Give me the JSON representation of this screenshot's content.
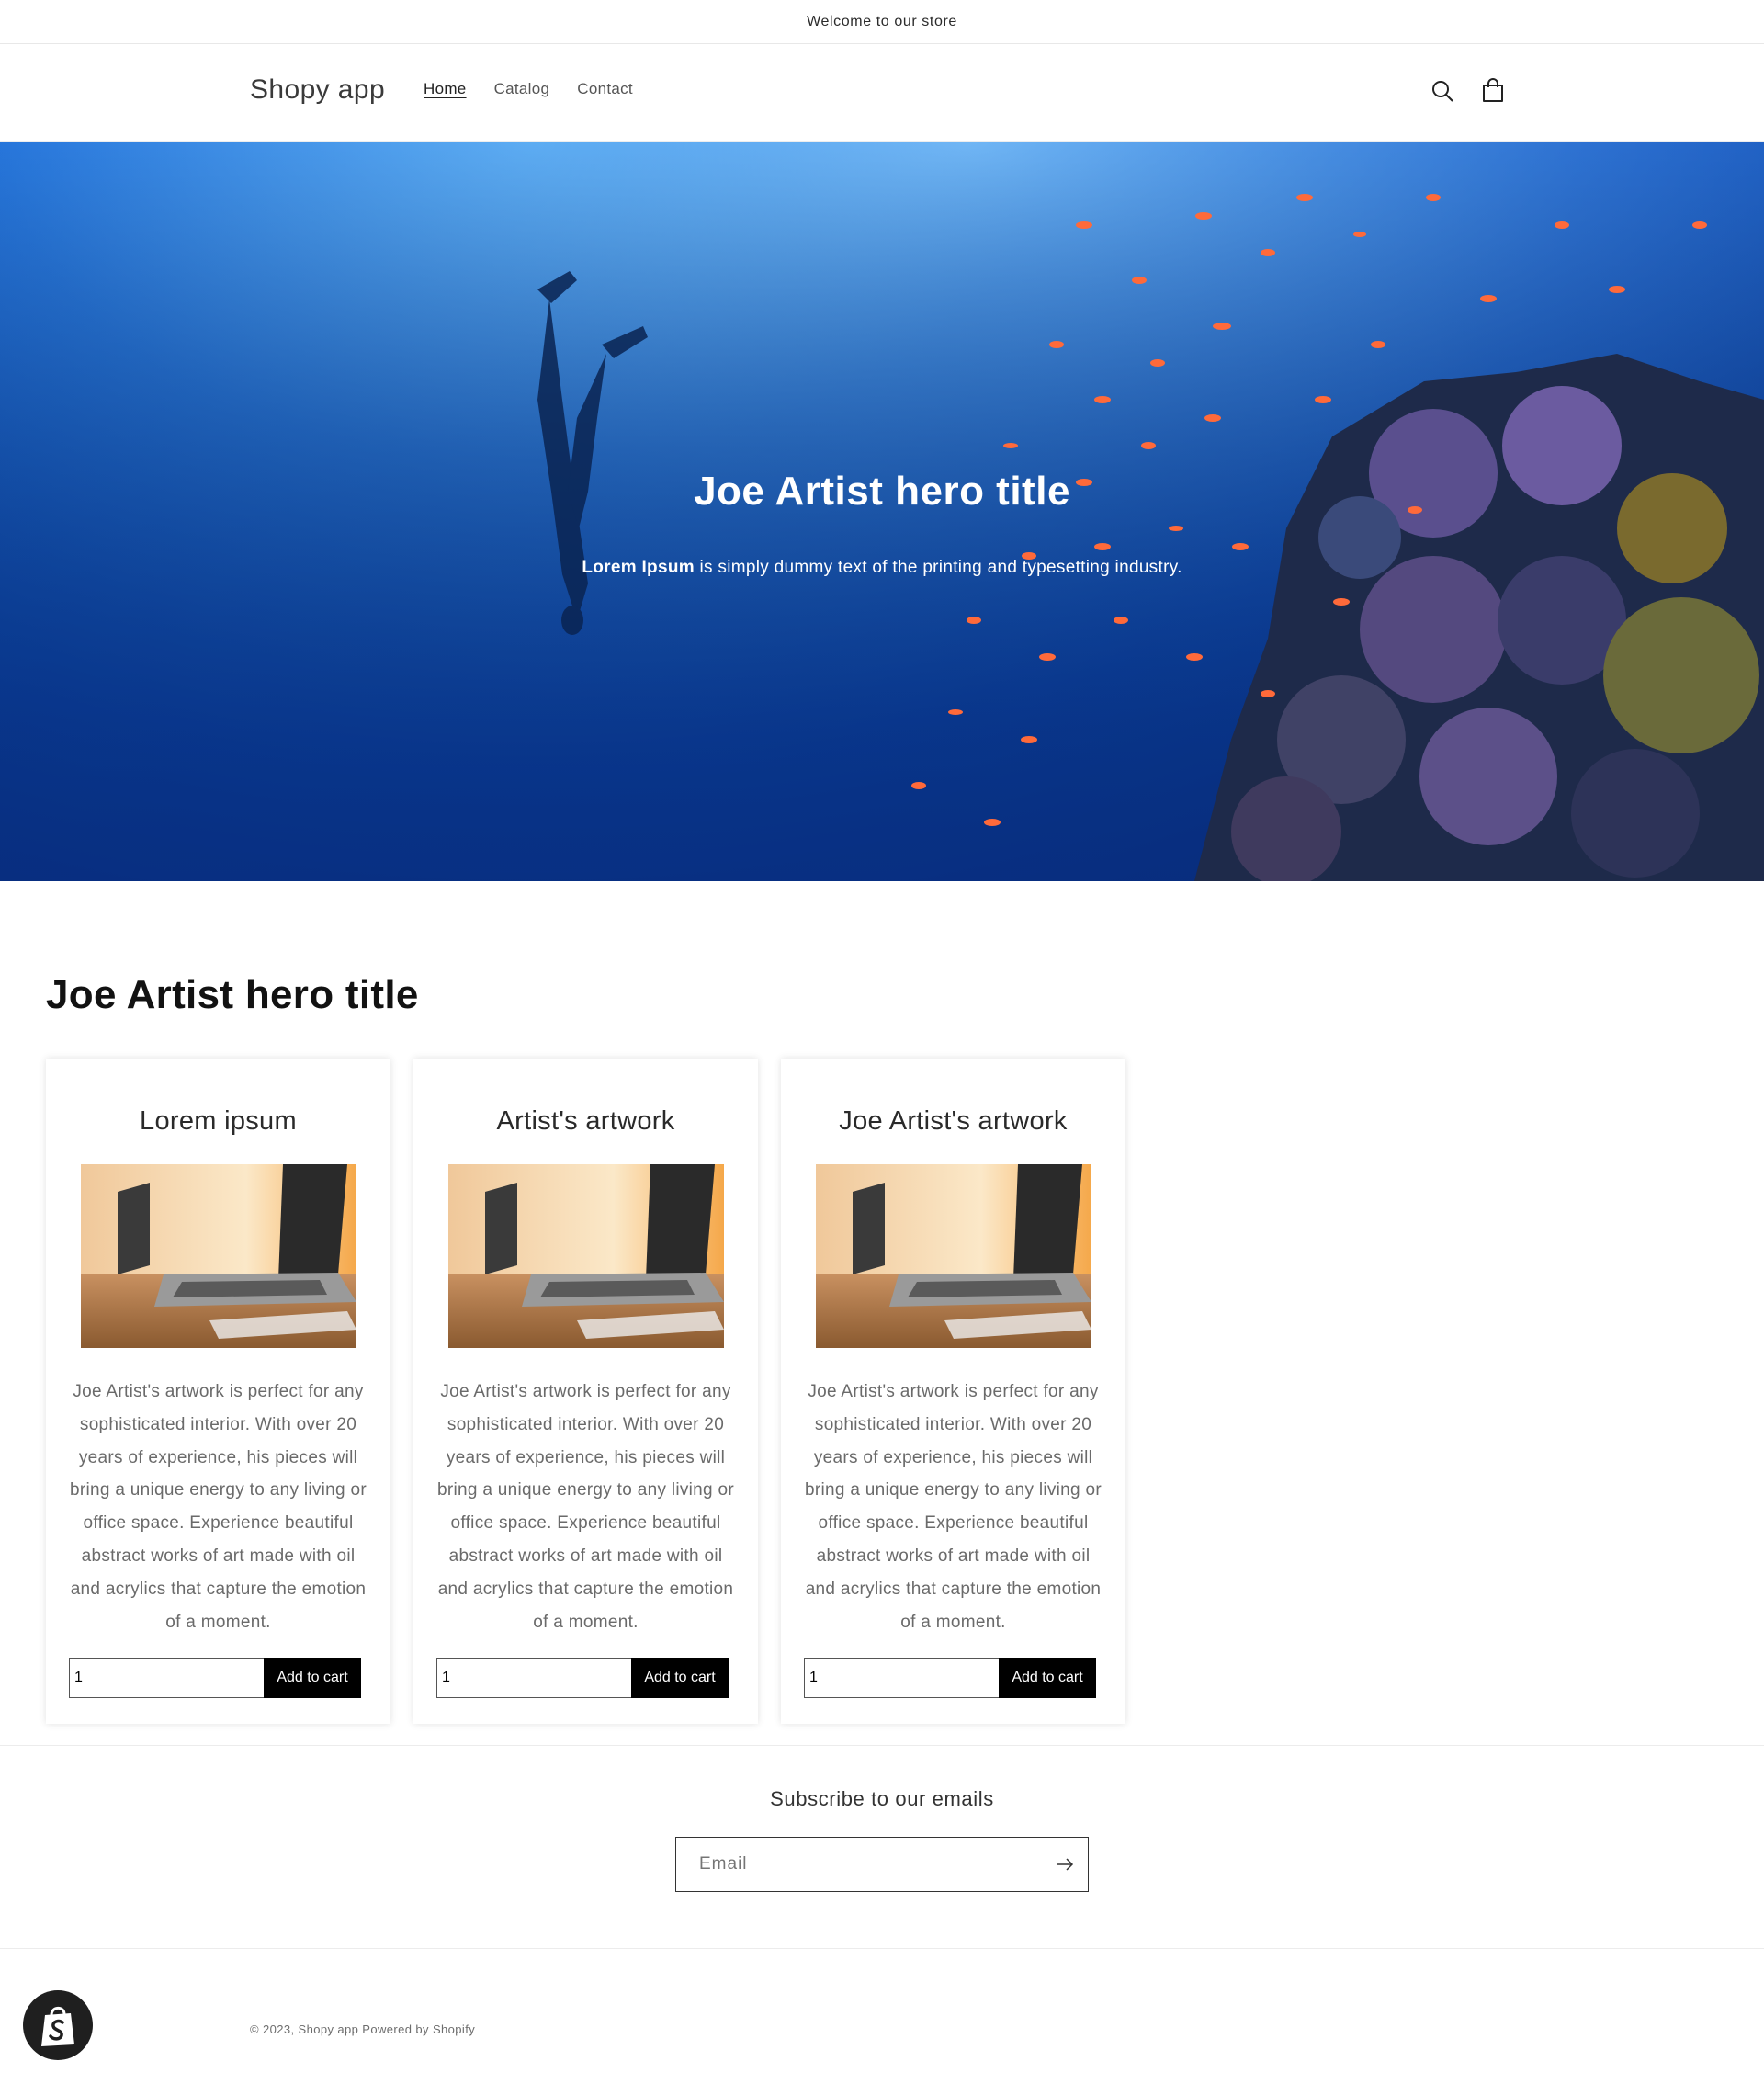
{
  "announcement": {
    "text": "Welcome to our store"
  },
  "header": {
    "brand": "Shopy app",
    "nav": [
      {
        "label": "Home",
        "active": true
      },
      {
        "label": "Catalog",
        "active": false
      },
      {
        "label": "Contact",
        "active": false
      }
    ],
    "icons": {
      "search": "search-icon",
      "cart": "cart-icon"
    }
  },
  "hero": {
    "title": "Joe Artist hero title",
    "subtitle_bold": "Lorem Ipsum",
    "subtitle_rest": " is simply dummy text of the printing and typesetting industry."
  },
  "products_section": {
    "title": "Joe Artist hero title",
    "cards": [
      {
        "title": "Lorem ipsum",
        "description": "Joe Artist's artwork is perfect for any sophisticated interior. With over 20 years of experience, his pieces will bring a unique energy to any living or office space. Experience beautiful abstract works of art made with oil and acrylics that capture the emotion of a moment.",
        "quantity": "1",
        "button_label": "Add to cart"
      },
      {
        "title": "Artist's artwork",
        "description": "Joe Artist's artwork is perfect for any sophisticated interior. With over 20 years of experience, his pieces will bring a unique energy to any living or office space. Experience beautiful abstract works of art made with oil and acrylics that capture the emotion of a moment.",
        "quantity": "1",
        "button_label": "Add to cart"
      },
      {
        "title": "Joe Artist's artwork",
        "description": "Joe Artist's artwork is perfect for any sophisticated interior. With over 20 years of experience, his pieces will bring a unique energy to any living or office space. Experience beautiful abstract works of art made with oil and acrylics that capture the emotion of a moment.",
        "quantity": "1",
        "button_label": "Add to cart"
      }
    ]
  },
  "newsletter": {
    "title": "Subscribe to our emails",
    "email_placeholder": "Email"
  },
  "footer": {
    "copyright": "© 2023, Shopy app Powered by Shopify"
  }
}
